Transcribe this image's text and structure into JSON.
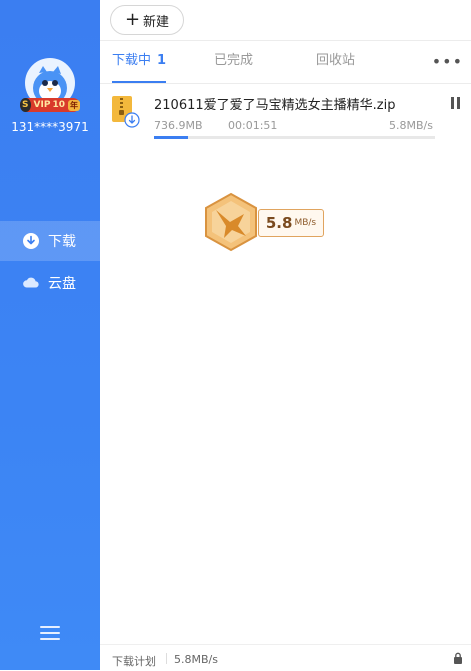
{
  "sidebar": {
    "username": "131****3971",
    "vip": {
      "badge_text": "VIP",
      "years": "10",
      "years_unit": "年",
      "s_mark": "S"
    },
    "nav": [
      {
        "label": "下载",
        "icon": "download-icon",
        "active": true
      },
      {
        "label": "云盘",
        "icon": "cloud-icon",
        "active": false
      }
    ],
    "menu_icon": "hamburger-menu-icon"
  },
  "toolbar": {
    "new_label": "新建",
    "new_icon": "plus-icon",
    "more_icon": "ellipsis-icon"
  },
  "tabs": [
    {
      "label": "下载中",
      "count": "1",
      "active": true
    },
    {
      "label": "已完成",
      "active": false
    },
    {
      "label": "回收站",
      "active": false
    }
  ],
  "task": {
    "file_name": "210611爱了爱了马宝精选女主播精华.zip",
    "size": "736.9MB",
    "elapsed": "00:01:51",
    "speed": "5.8MB/s",
    "progress": 0.12,
    "file_icon": "zip-file-icon",
    "action_icon": "pause-icon"
  },
  "speed_badge": {
    "value": "5.8",
    "unit": "MB/s",
    "icon": "bird-hexagon-icon"
  },
  "footer": {
    "plan_label": "下载计划",
    "speed": "5.8MB/s",
    "lock_icon": "lock-icon"
  },
  "colors": {
    "accent": "#3b7ef1",
    "sidebar": "#3c84f4",
    "vip_red": "#d93a2b",
    "badge_gold": "#e6a654"
  }
}
